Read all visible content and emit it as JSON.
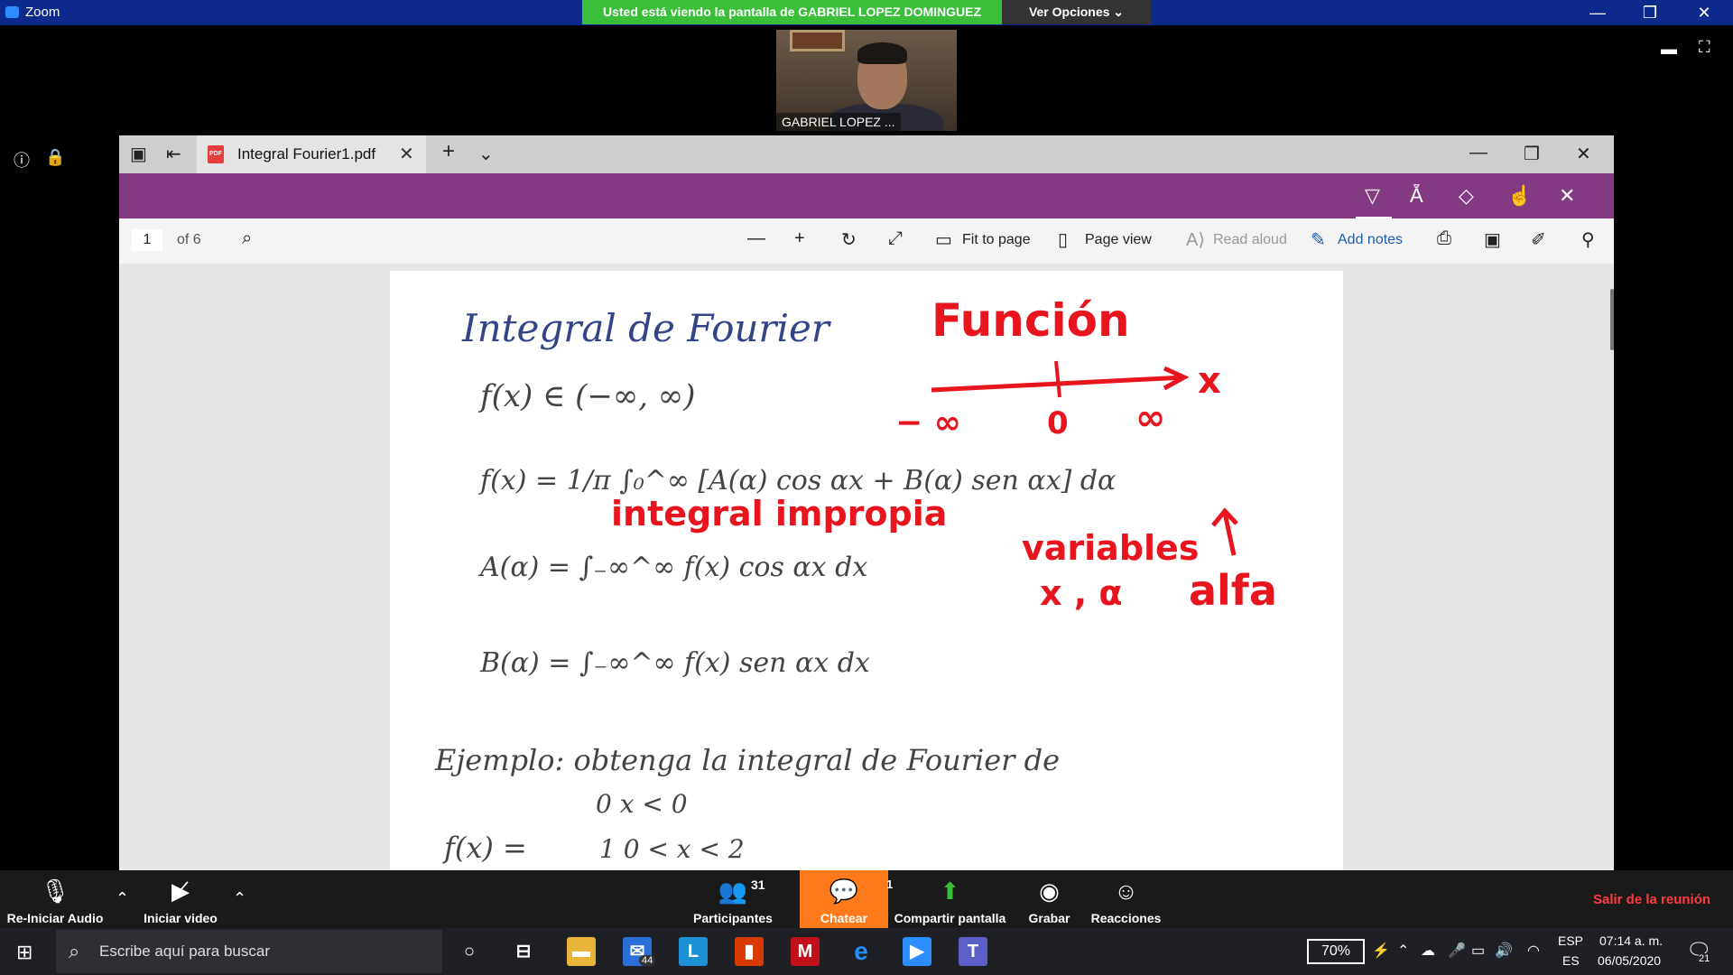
{
  "zoom": {
    "app_title": "Zoom",
    "share_banner": "Usted está viendo la pantalla de GABRIEL LOPEZ DOMINGUEZ",
    "view_options": "Ver Opciones ⌄",
    "speaker_name": "GABRIEL LOPEZ ..."
  },
  "edge": {
    "tab_title": "Integral Fourier1.pdf",
    "page_number": "1",
    "page_of": "of 6",
    "fit_to_page": "Fit to page",
    "page_view": "Page view",
    "read_aloud": "Read aloud",
    "add_notes": "Add notes"
  },
  "document": {
    "title": "Integral de Fourier",
    "line1": "f(x) ∈ (−∞, ∞)",
    "line2": "f(x) = 1/π ∫₀^∞ [A(α) cos αx + B(α) sen αx] dα",
    "line3": "A(α) = ∫₋∞^∞ f(x) cos αx dx",
    "line4": "B(α) = ∫₋∞^∞ f(x) sen αx dx",
    "example": "Ejemplo: obtenga la integral de Fourier de",
    "piece_lhs": "f(x) =",
    "piece1": "0     x < 0",
    "piece2": "1     0 < x < 2",
    "red_funcion": "Función",
    "red_axis_x": "x",
    "red_minus_inf": "− ∞",
    "red_zero": "0",
    "red_inf": "∞",
    "red_impropia": "integral impropia",
    "red_variables": "variables",
    "red_vars": "x , α",
    "red_alfa": "alfa"
  },
  "toolbar": {
    "reiniciar_audio": "Re-Iniciar Audio",
    "iniciar_video": "Iniciar video",
    "participantes": "Participantes",
    "participant_count": "31",
    "chatear": "Chatear",
    "chat_badge": "1",
    "compartir": "Compartir pantalla",
    "grabar": "Grabar",
    "reacciones": "Reacciones",
    "salir": "Salir de la reunión"
  },
  "taskbar": {
    "search_placeholder": "Escribe aquí para buscar",
    "mail_badge": "44",
    "battery": "70%",
    "lang_top": "ESP",
    "lang_bottom": "ES",
    "time": "07:14 a. m.",
    "date": "06/05/2020",
    "notif_count": "21"
  },
  "colors": {
    "ink_red": "#e8141e",
    "ink_blue": "#334488",
    "edge_purple": "#843a82",
    "chat_orange": "#ff7a1a",
    "share_green": "#3bbf3b"
  }
}
